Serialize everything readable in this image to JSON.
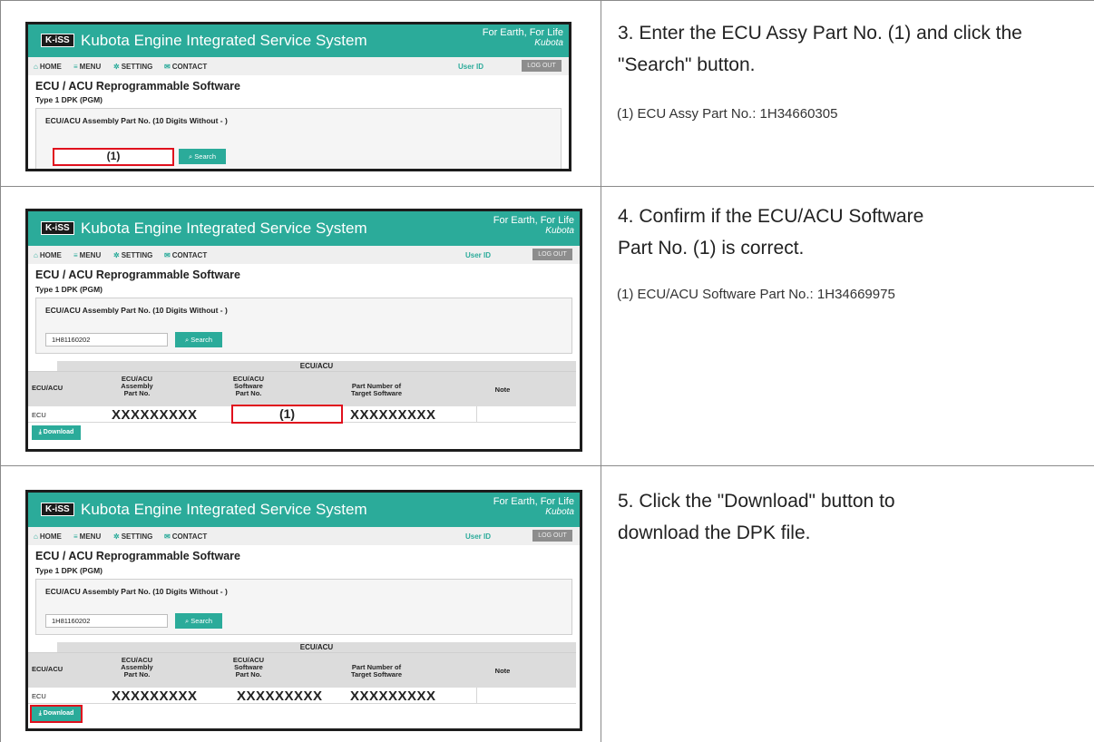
{
  "screens": {
    "app": {
      "badge": "K-iSS",
      "system_title": "Kubota Engine Integrated Service System",
      "tagline": "For Earth, For Life",
      "brand": "Kubota",
      "nav": {
        "home": "HOME",
        "menu": "MENU",
        "setting": "SETTING",
        "contact": "CONTACT"
      },
      "user_id": "User ID",
      "logout": "LOG OUT",
      "page_title": "ECU / ACU Reprogrammable Software",
      "page_subtitle": "Type 1 DPK (PGM)",
      "form_label": "ECU/ACU Assembly Part No. (10 Digits Without - )",
      "search_button": "Search",
      "download_button": "Download"
    },
    "input_value": "1H81160202",
    "callout": "(1)",
    "table": {
      "group_header": "ECU/ACU",
      "col_ecu_acu": "ECU/ACU",
      "col_assembly": "ECU/ACU Assembly Part No.",
      "col_software": "ECU/ACU Software Part No.",
      "col_target": "Part Number of Target Software",
      "col_note": "Note",
      "row_ecu": "ECU",
      "masked": "XXXXXXXXX"
    }
  },
  "steps": [
    {
      "text": "3. Enter the ECU Assy Part No. (1) and click the \"Search\" button.",
      "note": "(1)  ECU Assy Part No.: 1H34660305"
    },
    {
      "text": "4. Confirm if the ECU/ACU Software Part No. (1) is correct.",
      "note": "(1)  ECU/ACU Software Part No.: 1H34669975"
    },
    {
      "text": "5. Click the \"Download\" button to download the DPK file.",
      "note": ""
    }
  ],
  "colors": {
    "accent": "#2bab9a",
    "highlight": "#e0101d",
    "grid": "#8a8a8a"
  }
}
